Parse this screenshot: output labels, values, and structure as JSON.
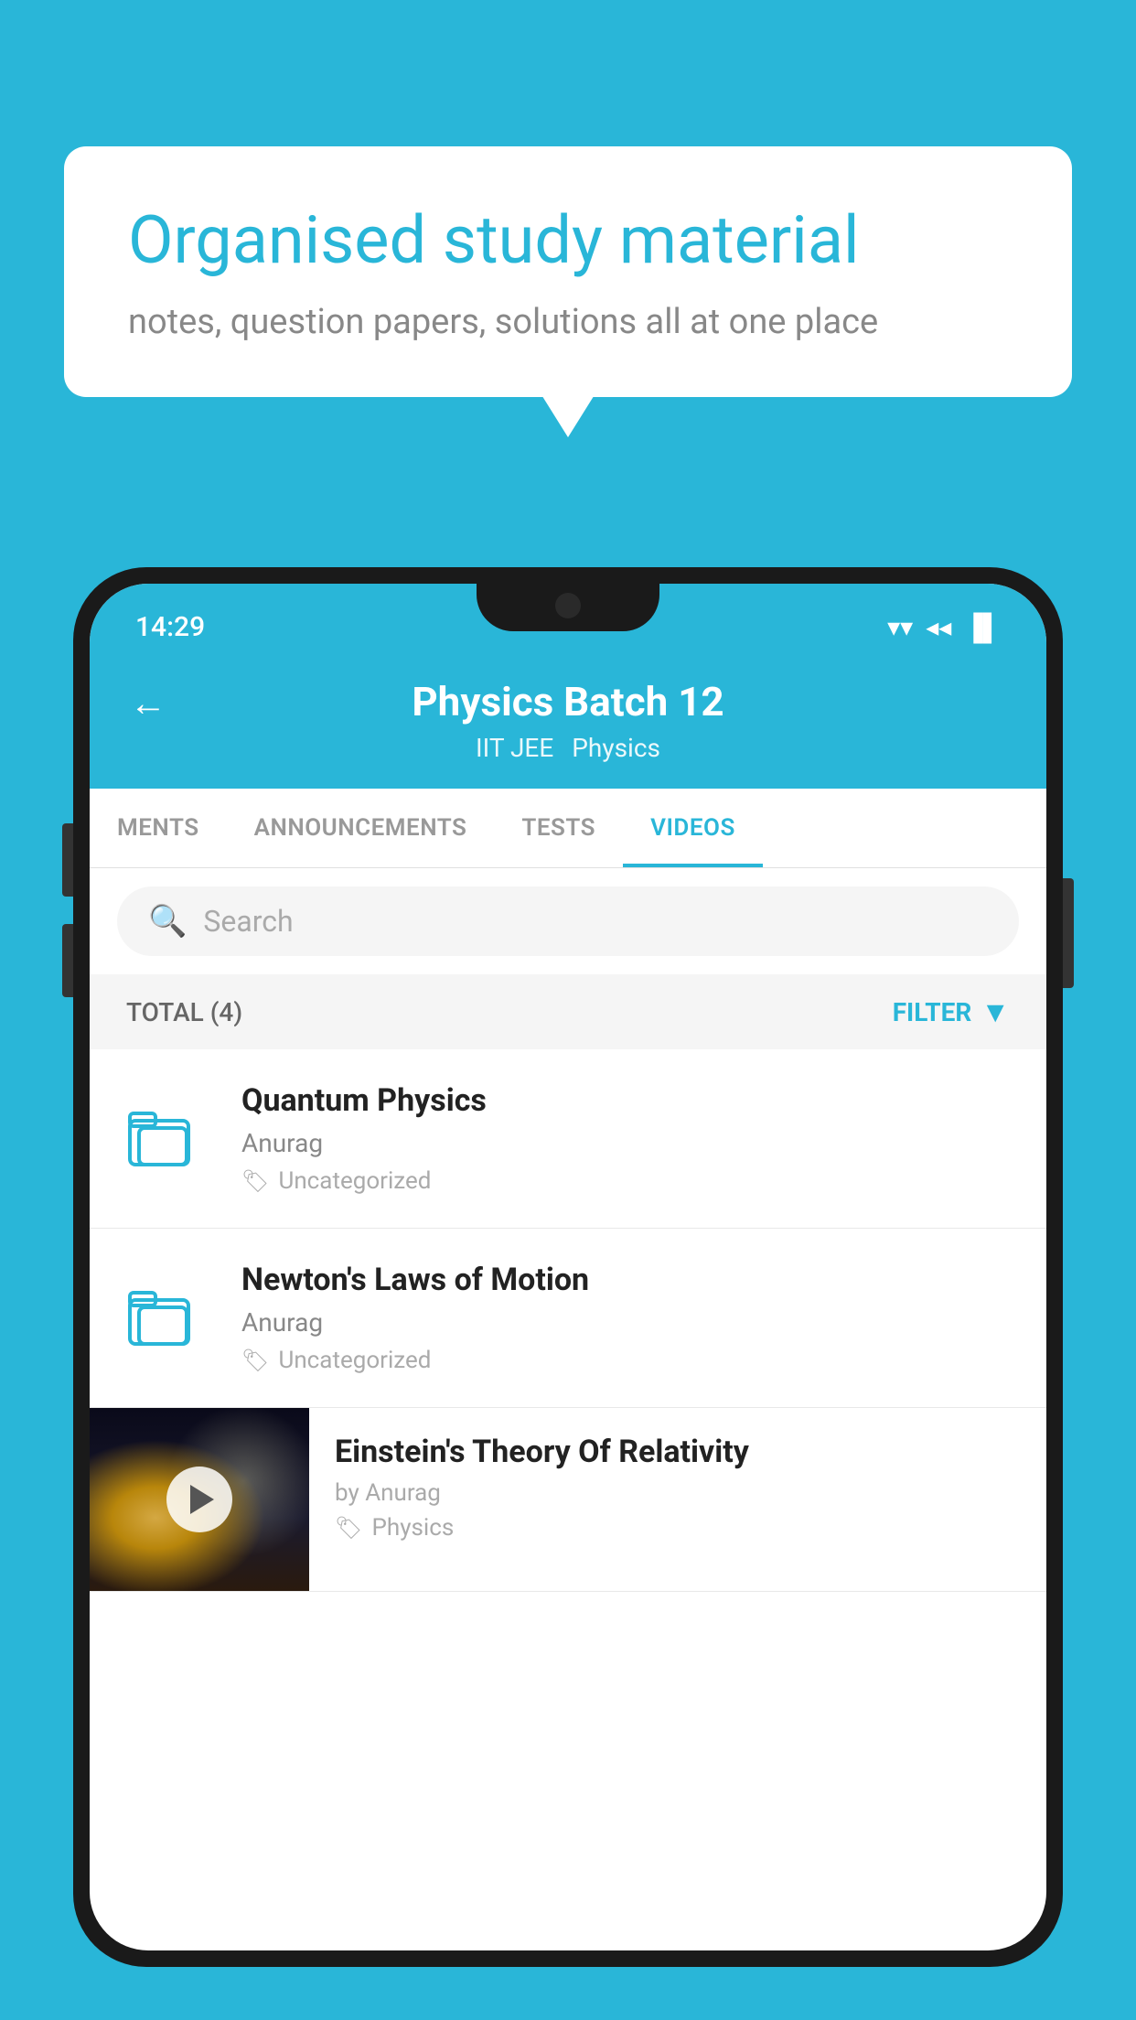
{
  "background_color": "#29b6d8",
  "speech_bubble": {
    "title": "Organised study material",
    "subtitle": "notes, question papers, solutions all at one place"
  },
  "status_bar": {
    "time": "14:29",
    "wifi": "▼",
    "signal": "▲",
    "battery": "▐"
  },
  "app_header": {
    "title": "Physics Batch 12",
    "tag1": "IIT JEE",
    "tag2": "Physics",
    "back_label": "←"
  },
  "tabs": [
    {
      "label": "MENTS",
      "active": false
    },
    {
      "label": "ANNOUNCEMENTS",
      "active": false
    },
    {
      "label": "TESTS",
      "active": false
    },
    {
      "label": "VIDEOS",
      "active": true
    }
  ],
  "search": {
    "placeholder": "Search"
  },
  "filter_row": {
    "total_label": "TOTAL (4)",
    "filter_label": "FILTER"
  },
  "videos": [
    {
      "title": "Quantum Physics",
      "author": "Anurag",
      "tag": "Uncategorized",
      "has_thumb": false
    },
    {
      "title": "Newton's Laws of Motion",
      "author": "Anurag",
      "tag": "Uncategorized",
      "has_thumb": false
    },
    {
      "title": "Einstein's Theory Of Relativity",
      "author": "by Anurag",
      "tag": "Physics",
      "has_thumb": true
    }
  ]
}
